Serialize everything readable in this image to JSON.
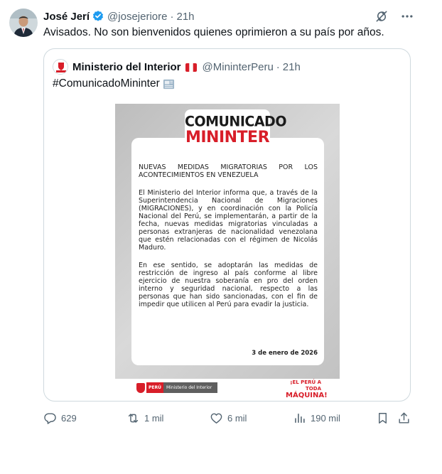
{
  "tweet": {
    "author_name": "José Jerí",
    "author_handle": "@josejeriore",
    "time": "21h",
    "separator": "·",
    "text": "Avisados. No son bienvenidos quienes oprimieron a su país por años."
  },
  "quoted": {
    "author_name": "Ministerio del Interior",
    "author_handle": "@MininterPeru",
    "time": "21h",
    "separator": "·",
    "text": "#ComunicadoMininter",
    "image": {
      "badge_line1": "COMUNICADO",
      "badge_line2": "MININTER",
      "title": "NUEVAS MEDIDAS MIGRATORIAS POR LOS ACONTECIMIENTOS EN VENEZUELA",
      "paragraph1": "El Ministerio del Interior informa que, a través de la Superintendencia Nacional de Migraciones (MIGRACIONES), y en coordinación con la Policía Nacional del Perú, se implementarán, a partir de la fecha, nuevas medidas migratorias vinculadas a personas extranjeras de nacionalidad venezolana que estén relacionadas con el régimen de Nicolás Maduro.",
      "paragraph2": "En ese sentido, se adoptarán las medidas de restricción de ingreso al país conforme al libre ejercicio de nuestra soberanía en pro del orden interno y seguridad nacional, respecto a las personas que han sido sancionadas, con el fin de impedir que utilicen al Perú para evadir la justicia.",
      "date": "3 de enero de 2026",
      "logo_country": "PERÚ",
      "logo_ministry": "Ministerio del Interior",
      "slogan_line1": "¡EL PERÚ A TODA",
      "slogan_line2": "MÁQUINA!"
    }
  },
  "actions": {
    "replies": "629",
    "reposts": "1 mil",
    "likes": "6 mil",
    "views": "190 mil"
  },
  "colors": {
    "verified_blue": "#1d9bf0",
    "muted_text": "#536471",
    "border": "#cfd9de",
    "mininter_red": "#d81e29"
  },
  "icons": [
    "verified-badge-icon",
    "grok-icon",
    "more-icon",
    "peru-flag-icon",
    "newspaper-icon",
    "reply-icon",
    "repost-icon",
    "like-icon",
    "views-icon",
    "bookmark-icon",
    "share-icon"
  ]
}
